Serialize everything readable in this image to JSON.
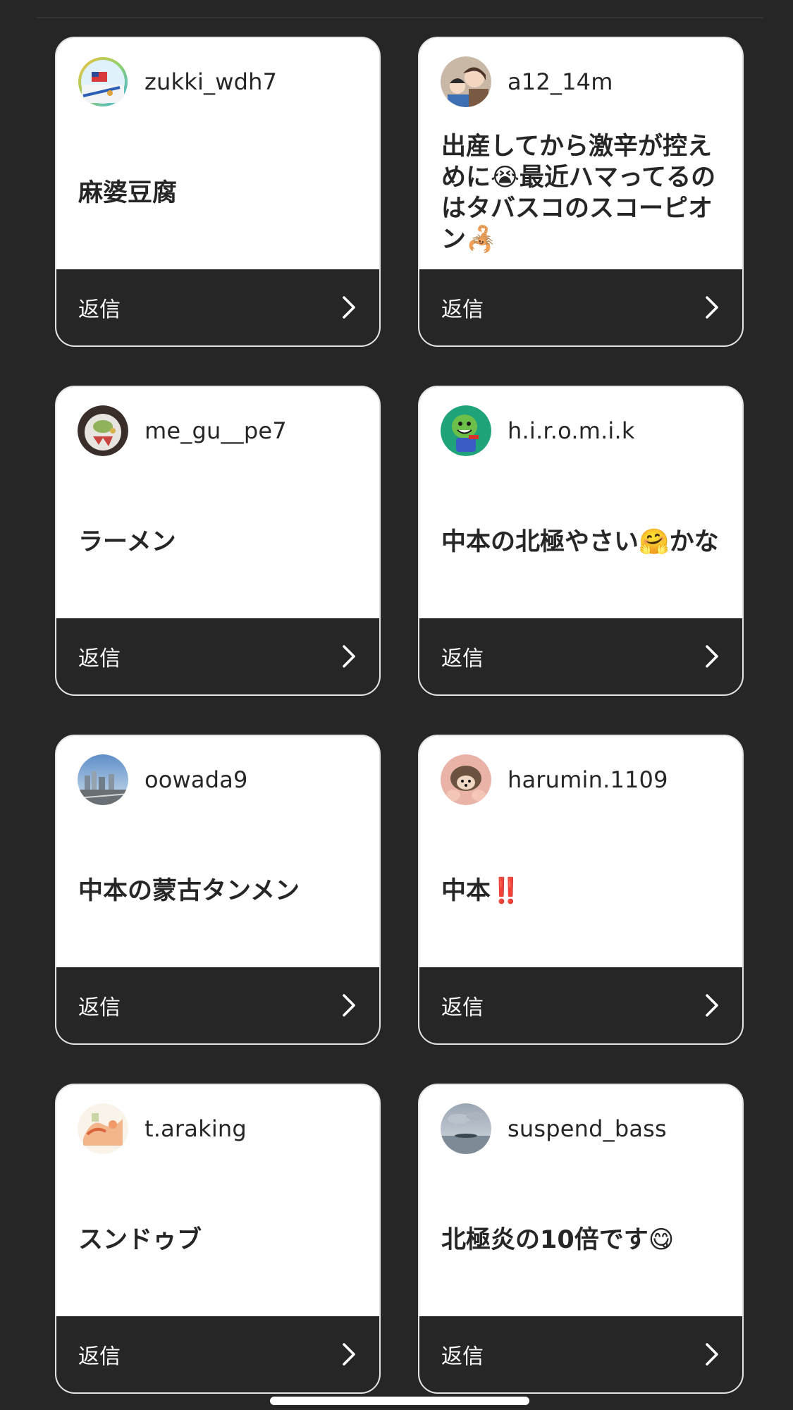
{
  "reply_label": "返信",
  "cards": [
    {
      "username": "zukki_wdh7",
      "answer": "麻婆豆腐"
    },
    {
      "username": "a12_14m",
      "answer": "出産してから激辛が控えめに😭最近ハマってるのはタバスコのスコーピオン🦂"
    },
    {
      "username": "me_gu__pe7",
      "answer": "ラーメン"
    },
    {
      "username": "h.i.r.o.m.i.k",
      "answer": "中本の北極やさい🤗かな"
    },
    {
      "username": "oowada9",
      "answer": "中本の蒙古タンメン"
    },
    {
      "username": "harumin.1109",
      "answer": "中本‼️"
    },
    {
      "username": "t.araking",
      "answer": "スンドゥブ"
    },
    {
      "username": "suspend_bass",
      "answer": "北極炎の10倍です😋"
    }
  ],
  "colors": {
    "background": "#262626",
    "card": "#ffffff",
    "card_footer": "#262626",
    "text_dark": "#262626",
    "text_light": "#ffffff"
  },
  "icons": [
    "chevron-right-icon"
  ]
}
